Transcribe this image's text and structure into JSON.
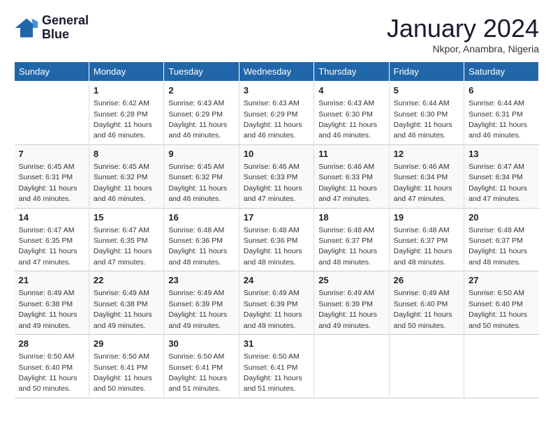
{
  "header": {
    "logo_line1": "General",
    "logo_line2": "Blue",
    "month": "January 2024",
    "location": "Nkpor, Anambra, Nigeria"
  },
  "columns": [
    "Sunday",
    "Monday",
    "Tuesday",
    "Wednesday",
    "Thursday",
    "Friday",
    "Saturday"
  ],
  "weeks": [
    [
      {
        "day": "",
        "info": ""
      },
      {
        "day": "1",
        "info": "Sunrise: 6:42 AM\nSunset: 6:28 PM\nDaylight: 11 hours\nand 46 minutes."
      },
      {
        "day": "2",
        "info": "Sunrise: 6:43 AM\nSunset: 6:29 PM\nDaylight: 11 hours\nand 46 minutes."
      },
      {
        "day": "3",
        "info": "Sunrise: 6:43 AM\nSunset: 6:29 PM\nDaylight: 11 hours\nand 46 minutes."
      },
      {
        "day": "4",
        "info": "Sunrise: 6:43 AM\nSunset: 6:30 PM\nDaylight: 11 hours\nand 46 minutes."
      },
      {
        "day": "5",
        "info": "Sunrise: 6:44 AM\nSunset: 6:30 PM\nDaylight: 11 hours\nand 46 minutes."
      },
      {
        "day": "6",
        "info": "Sunrise: 6:44 AM\nSunset: 6:31 PM\nDaylight: 11 hours\nand 46 minutes."
      }
    ],
    [
      {
        "day": "7",
        "info": "Sunrise: 6:45 AM\nSunset: 6:31 PM\nDaylight: 11 hours\nand 46 minutes."
      },
      {
        "day": "8",
        "info": "Sunrise: 6:45 AM\nSunset: 6:32 PM\nDaylight: 11 hours\nand 46 minutes."
      },
      {
        "day": "9",
        "info": "Sunrise: 6:45 AM\nSunset: 6:32 PM\nDaylight: 11 hours\nand 46 minutes."
      },
      {
        "day": "10",
        "info": "Sunrise: 6:46 AM\nSunset: 6:33 PM\nDaylight: 11 hours\nand 47 minutes."
      },
      {
        "day": "11",
        "info": "Sunrise: 6:46 AM\nSunset: 6:33 PM\nDaylight: 11 hours\nand 47 minutes."
      },
      {
        "day": "12",
        "info": "Sunrise: 6:46 AM\nSunset: 6:34 PM\nDaylight: 11 hours\nand 47 minutes."
      },
      {
        "day": "13",
        "info": "Sunrise: 6:47 AM\nSunset: 6:34 PM\nDaylight: 11 hours\nand 47 minutes."
      }
    ],
    [
      {
        "day": "14",
        "info": "Sunrise: 6:47 AM\nSunset: 6:35 PM\nDaylight: 11 hours\nand 47 minutes."
      },
      {
        "day": "15",
        "info": "Sunrise: 6:47 AM\nSunset: 6:35 PM\nDaylight: 11 hours\nand 47 minutes."
      },
      {
        "day": "16",
        "info": "Sunrise: 6:48 AM\nSunset: 6:36 PM\nDaylight: 11 hours\nand 48 minutes."
      },
      {
        "day": "17",
        "info": "Sunrise: 6:48 AM\nSunset: 6:36 PM\nDaylight: 11 hours\nand 48 minutes."
      },
      {
        "day": "18",
        "info": "Sunrise: 6:48 AM\nSunset: 6:37 PM\nDaylight: 11 hours\nand 48 minutes."
      },
      {
        "day": "19",
        "info": "Sunrise: 6:48 AM\nSunset: 6:37 PM\nDaylight: 11 hours\nand 48 minutes."
      },
      {
        "day": "20",
        "info": "Sunrise: 6:48 AM\nSunset: 6:37 PM\nDaylight: 11 hours\nand 48 minutes."
      }
    ],
    [
      {
        "day": "21",
        "info": "Sunrise: 6:49 AM\nSunset: 6:38 PM\nDaylight: 11 hours\nand 49 minutes."
      },
      {
        "day": "22",
        "info": "Sunrise: 6:49 AM\nSunset: 6:38 PM\nDaylight: 11 hours\nand 49 minutes."
      },
      {
        "day": "23",
        "info": "Sunrise: 6:49 AM\nSunset: 6:39 PM\nDaylight: 11 hours\nand 49 minutes."
      },
      {
        "day": "24",
        "info": "Sunrise: 6:49 AM\nSunset: 6:39 PM\nDaylight: 11 hours\nand 49 minutes."
      },
      {
        "day": "25",
        "info": "Sunrise: 6:49 AM\nSunset: 6:39 PM\nDaylight: 11 hours\nand 49 minutes."
      },
      {
        "day": "26",
        "info": "Sunrise: 6:49 AM\nSunset: 6:40 PM\nDaylight: 11 hours\nand 50 minutes."
      },
      {
        "day": "27",
        "info": "Sunrise: 6:50 AM\nSunset: 6:40 PM\nDaylight: 11 hours\nand 50 minutes."
      }
    ],
    [
      {
        "day": "28",
        "info": "Sunrise: 6:50 AM\nSunset: 6:40 PM\nDaylight: 11 hours\nand 50 minutes."
      },
      {
        "day": "29",
        "info": "Sunrise: 6:50 AM\nSunset: 6:41 PM\nDaylight: 11 hours\nand 50 minutes."
      },
      {
        "day": "30",
        "info": "Sunrise: 6:50 AM\nSunset: 6:41 PM\nDaylight: 11 hours\nand 51 minutes."
      },
      {
        "day": "31",
        "info": "Sunrise: 6:50 AM\nSunset: 6:41 PM\nDaylight: 11 hours\nand 51 minutes."
      },
      {
        "day": "",
        "info": ""
      },
      {
        "day": "",
        "info": ""
      },
      {
        "day": "",
        "info": ""
      }
    ]
  ]
}
